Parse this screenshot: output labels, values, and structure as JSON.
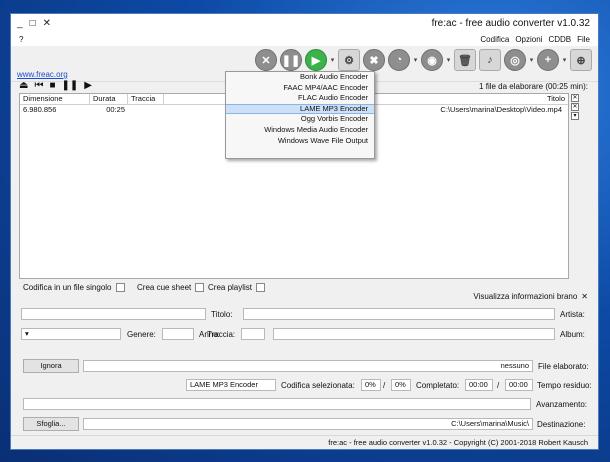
{
  "window": {
    "title": "fre:ac - free audio converter v1.0.32",
    "controls": [
      "_",
      "□",
      "✕"
    ]
  },
  "menubar": {
    "help": "?",
    "items": [
      "File",
      "CDDB",
      "Opzioni",
      "Codifica"
    ]
  },
  "toolbar": {
    "website": "www.freac.org"
  },
  "encoder_menu": {
    "items": [
      "Bonk Audio Encoder",
      "FAAC MP4/AAC Encoder",
      "FLAC Audio Encoder",
      "LAME MP3 Encoder",
      "Ogg Vorbis Encoder",
      "Windows Media Audio Encoder",
      "Windows Wave File Output"
    ],
    "selected": 3
  },
  "files_info": "1 file da elaborare (00:25 min):",
  "list": {
    "columns": [
      "Titolo",
      "Traccia",
      "Durata",
      "Dimensione"
    ],
    "rows": [
      {
        "title": "C:\\Users\\marina\\Desktop\\Video.mp4",
        "track": "",
        "duration": "00:25",
        "size": "6.980.856"
      }
    ]
  },
  "options": {
    "playlist": "Crea playlist",
    "cue": "Crea cue sheet",
    "single": "Codifica in un file singolo"
  },
  "tag_section": {
    "title": "Visualizza informazioni brano",
    "artist_label": "Artista:",
    "title_label": "Titolo:",
    "album_label": "Album:",
    "track_label": "Traccia:",
    "year_label": "Anno:",
    "genre_label": "Genere:"
  },
  "progress": {
    "file_label": "File elaborato:",
    "file_value": "nessuno",
    "ignore_button": "Ignora",
    "time_label": "Tempo residuo:",
    "time_left": "00:00",
    "time_sep": "/",
    "time_total": "00:00",
    "completed_label": "Completato:",
    "pct_a": "0%",
    "pct_sep": "/",
    "pct_b": "0%",
    "encoder_label": "Codifica selezionata:",
    "encoder_value": "LAME MP3 Encoder",
    "progress_label": "Avanzamento:",
    "dest_label": "Destinazione:",
    "dest_value": "C:\\Users\\marina\\Music\\",
    "browse_button": "Sfoglia..."
  },
  "status": "fre:ac - free audio converter v1.0.32 - Copyright (C) 2001-2018 Robert Kausch",
  "colors": {
    "link": "#1a4fd0",
    "selection": "#cce0f7",
    "play_green": "#3bb24a"
  }
}
